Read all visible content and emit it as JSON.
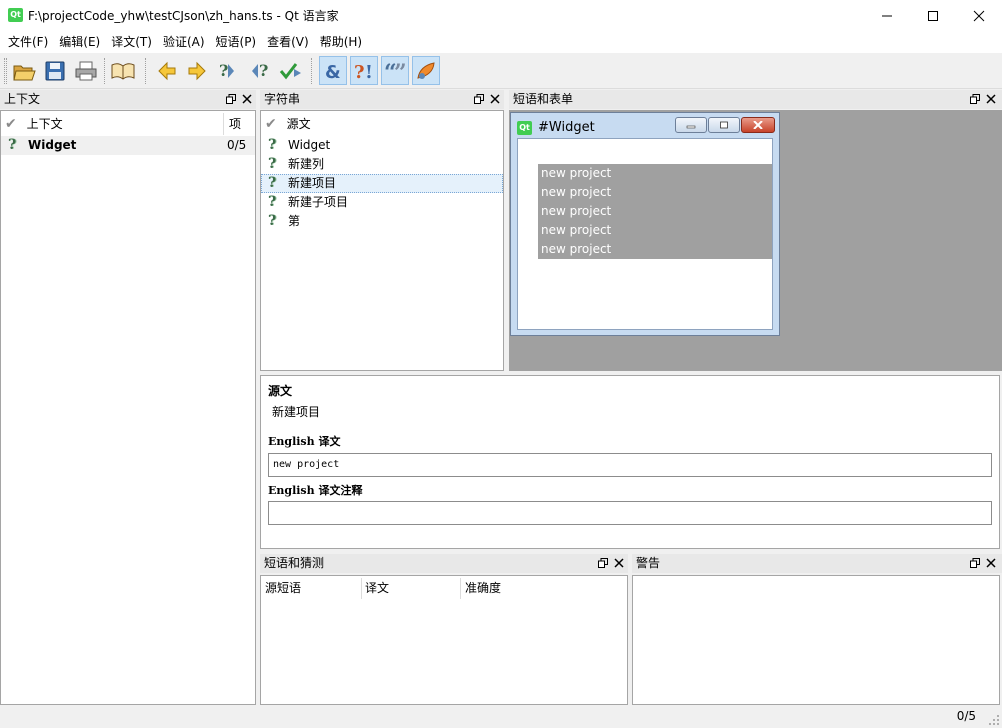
{
  "window": {
    "title": "F:\\projectCode_yhw\\testCJson\\zh_hans.ts - Qt 语言家",
    "app_logo_text": "Qt"
  },
  "menu": [
    "文件(F)",
    "编辑(E)",
    "译文(T)",
    "验证(A)",
    "短语(P)",
    "查看(V)",
    "帮助(H)"
  ],
  "context_panel": {
    "title": "上下文",
    "headers": {
      "name": "上下文",
      "items": "项"
    },
    "rows": [
      {
        "name": "Widget",
        "count": "0/5"
      }
    ]
  },
  "strings_panel": {
    "title": "字符串",
    "header": "源文",
    "rows": [
      "Widget",
      "新建列",
      "新建项目",
      "新建子项目",
      "第"
    ],
    "selected_index": 2
  },
  "forms_panel": {
    "title": "短语和表单",
    "preview_window": {
      "logo_text": "Qt",
      "title": "#Widget",
      "items": [
        "new project",
        "new project",
        "new project",
        "new project",
        "new project"
      ]
    }
  },
  "editor": {
    "source_label": "源文",
    "source_text": "新建项目",
    "translation_label": "English 译文",
    "translation_value": "new project",
    "comment_label": "English 译文注释",
    "comment_value": ""
  },
  "phrases_panel": {
    "title": "短语和猜测",
    "headers": [
      "源短语",
      "译文",
      "准确度"
    ]
  },
  "warnings_panel": {
    "title": "警告"
  },
  "status": {
    "count": "0/5"
  },
  "colors": {
    "accent_selection": "#cce8ff",
    "qt_green": "#41cd52",
    "preview_gray": "#a0a0a0",
    "toolbar_active": "#cbe3f7"
  }
}
